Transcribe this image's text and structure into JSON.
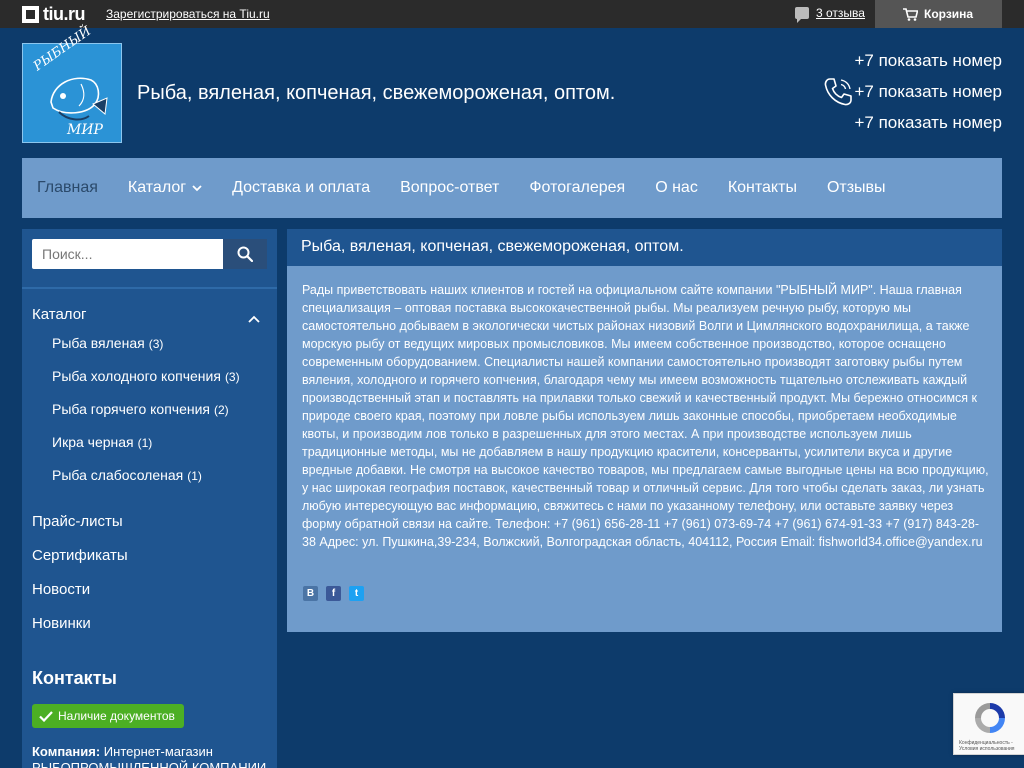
{
  "topbar": {
    "logo_text": "tiu.ru",
    "register_link": "Зарегистрироваться на Tiu.ru",
    "reviews_link": "3 отзыва",
    "cart_label": "Корзина"
  },
  "header": {
    "logo_text_top": "РЫБНЫЙ",
    "logo_text_bottom": "МИР",
    "site_title": "Рыба, вяленая, копченая, свежемороженая, оптом.",
    "phones": [
      "+7 показать номер",
      "+7 показать номер",
      "+7 показать номер"
    ]
  },
  "nav": {
    "items": [
      {
        "label": "Главная"
      },
      {
        "label": "Каталог"
      },
      {
        "label": "Доставка и оплата"
      },
      {
        "label": "Вопрос-ответ"
      },
      {
        "label": "Фотогалерея"
      },
      {
        "label": "О нас"
      },
      {
        "label": "Контакты"
      },
      {
        "label": "Отзывы"
      }
    ]
  },
  "sidebar": {
    "search_placeholder": "Поиск...",
    "catalog_title": "Каталог",
    "catalog_items": [
      {
        "label": "Рыба вяленая",
        "count": "(3)"
      },
      {
        "label": "Рыба холодного копчения",
        "count": "(3)"
      },
      {
        "label": "Рыба горячего копчения",
        "count": "(2)"
      },
      {
        "label": "Икра черная",
        "count": "(1)"
      },
      {
        "label": "Рыба слабосоленая",
        "count": "(1)"
      }
    ],
    "links": [
      "Прайс-листы",
      "Сертификаты",
      "Новости",
      "Новинки"
    ],
    "contacts_title": "Контакты",
    "docs_badge": "Наличие документов",
    "company_label": "Компания:",
    "company_value": "Интернет-магазин РЫБОПРОМЫШЛЕННОЙ КОМПАНИИ"
  },
  "main": {
    "heading": "Рыба, вяленая, копченая, свежемороженая, оптом.",
    "body": "Рады приветствовать наших клиентов и гостей на официальном сайте компании \"РЫБНЫЙ МИР\". Наша главная специализация – оптовая поставка высококачественной рыбы. Мы реализуем речную рыбу, которую мы самостоятельно добываем в экологически чистых районах низовий Волги и Цимлянского водохранилища, а также морскую рыбу от ведущих мировых промысловиков. Мы имеем собственное производство, которое оснащено современным оборудованием. Специалисты нашей компании самостоятельно производят заготовку рыбы путем вяления, холодного и горячего копчения, благодаря чему мы имеем возможность тщательно отслеживать каждый производственный этап и поставлять на прилавки только свежий и качественный продукт. Мы бережно относимся к природе своего края, поэтому при ловле рыбы используем лишь законные способы, приобретаем необходимые квоты, и производим лов только в разрешенных для этого местах. А при производстве используем лишь традиционные методы, мы не добавляем в нашу продукцию красители, консерванты, усилители вкуса и другие вредные добавки. Не смотря на высокое качество товаров, мы предлагаем самые выгодные цены на всю продукцию, у нас широкая география поставок, качественный товар и отличный сервис. Для того чтобы сделать заказ, ли узнать любую интересующую вас информацию, свяжитесь с нами по указанному телефону, или оставьте заявку через форму обратной связи на сайте. Телефон: +7 (961) 656-28-11 +7 (961) 073-69-74 +7 (961) 674-91-33 +7 (917) 843-28-38 Адрес: ул. Пушкина,39-234, Волжский, Волгоградская область, 404112, Россия Email: fishworld34.office@yandex.ru",
    "social": [
      {
        "icon": "vk-icon",
        "glyph": "В"
      },
      {
        "icon": "facebook-icon",
        "glyph": "f"
      },
      {
        "icon": "twitter-icon",
        "glyph": "t"
      }
    ]
  },
  "recaptcha": {
    "text": "Конфиденциальность - Условия использования"
  },
  "colors": {
    "page_bg": "#0d3b6b",
    "nav_bg": "#6f9bcb",
    "panel_dark": "#1f5590",
    "badge_green": "#4caf24"
  }
}
